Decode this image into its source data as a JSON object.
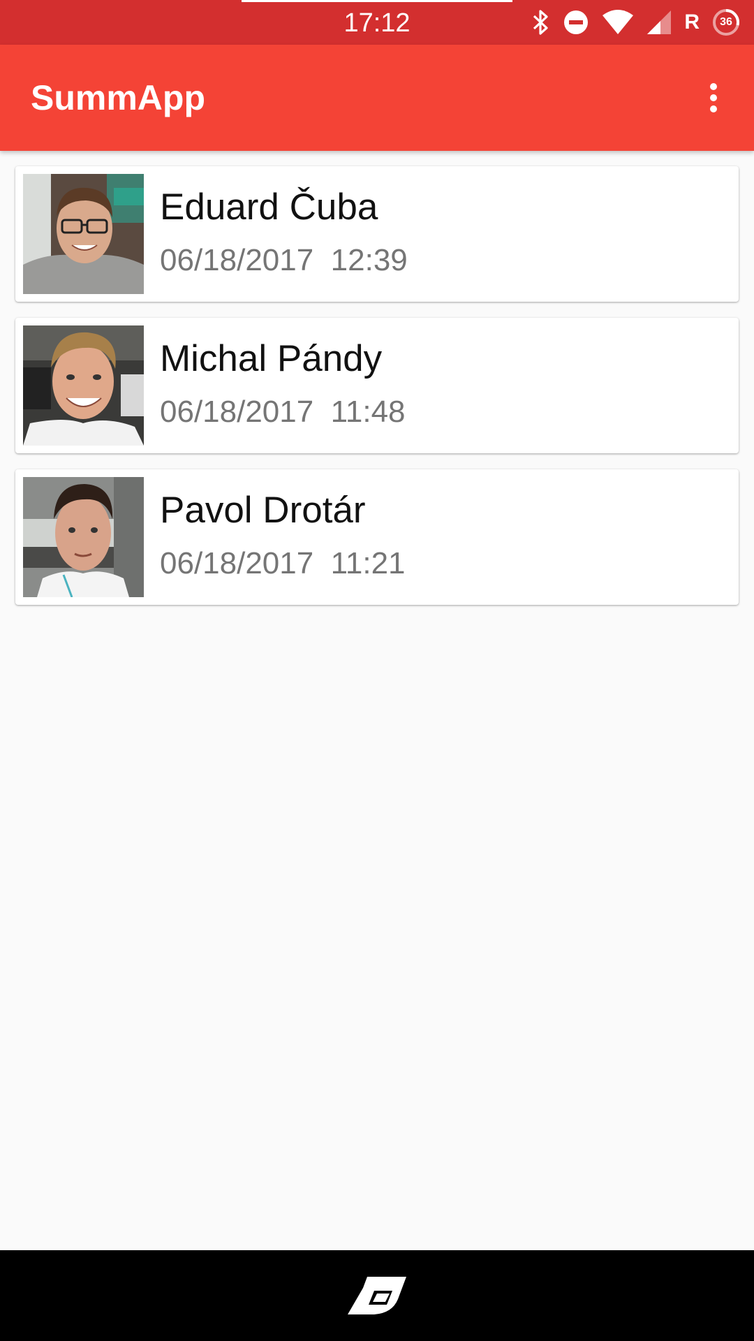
{
  "status_bar": {
    "time": "17:12",
    "network_label": "R",
    "battery_level": "36",
    "icons": [
      "bluetooth-icon",
      "do-not-disturb-icon",
      "wifi-icon",
      "cellular-signal-icon",
      "battery-icon"
    ]
  },
  "app_bar": {
    "title": "SummApp",
    "menu_icon": "more-vert-icon"
  },
  "colors": {
    "status_bar": "#d32f2f",
    "app_bar": "#f44336",
    "background": "#fafafa",
    "date_text": "#757575"
  },
  "entries": [
    {
      "name": "Eduard Čuba",
      "datetime": "06/18/2017  12:39"
    },
    {
      "name": "Michal Pándy",
      "datetime": "06/18/2017  11:48"
    },
    {
      "name": "Pavol Drotár",
      "datetime": "06/18/2017  11:21"
    }
  ],
  "nav_bar": {
    "icon": "oem-logo-icon"
  }
}
